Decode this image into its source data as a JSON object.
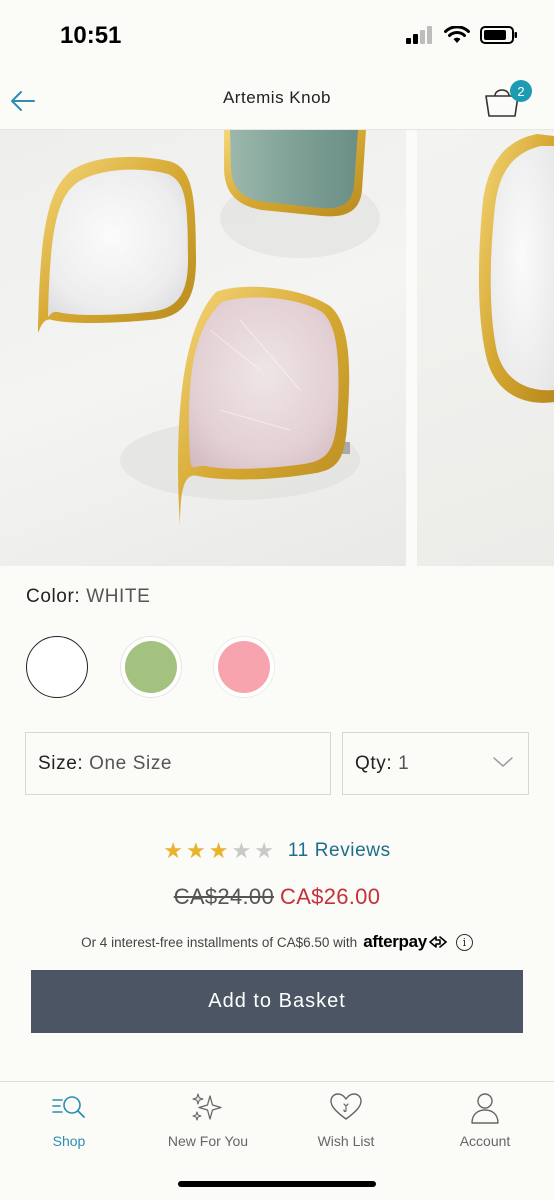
{
  "status_bar": {
    "time": "10:51"
  },
  "header": {
    "title": "Artemis Knob",
    "basket_count": "2"
  },
  "product": {
    "color_label": "Color:",
    "color_value": "WHITE",
    "swatches": [
      {
        "name": "white",
        "color": "#ffffff"
      },
      {
        "name": "green",
        "color": "#a3c27f"
      },
      {
        "name": "pink",
        "color": "#f7a4ae"
      }
    ],
    "size_label": "Size:",
    "size_value": "One Size",
    "qty_label": "Qty:",
    "qty_value": "1",
    "rating": 3,
    "rating_max": 5,
    "reviews_label": "11 Reviews",
    "price_old": "CA$24.00",
    "price_new": "CA$26.00",
    "afterpay_text": "Or 4 interest-free installments of CA$6.50 with",
    "afterpay_brand": "afterpay",
    "add_button": "Add to Basket"
  },
  "colors": {
    "accent": "#1c9cb0",
    "sale": "#c4323a",
    "button": "#4b5563",
    "star": "#e9b32d"
  },
  "tabs": [
    {
      "label": "Shop",
      "icon": "shop-search-icon",
      "active": true
    },
    {
      "label": "New For You",
      "icon": "sparkles-icon",
      "active": false
    },
    {
      "label": "Wish List",
      "icon": "heart-icon",
      "active": false
    },
    {
      "label": "Account",
      "icon": "person-icon",
      "active": false
    }
  ]
}
